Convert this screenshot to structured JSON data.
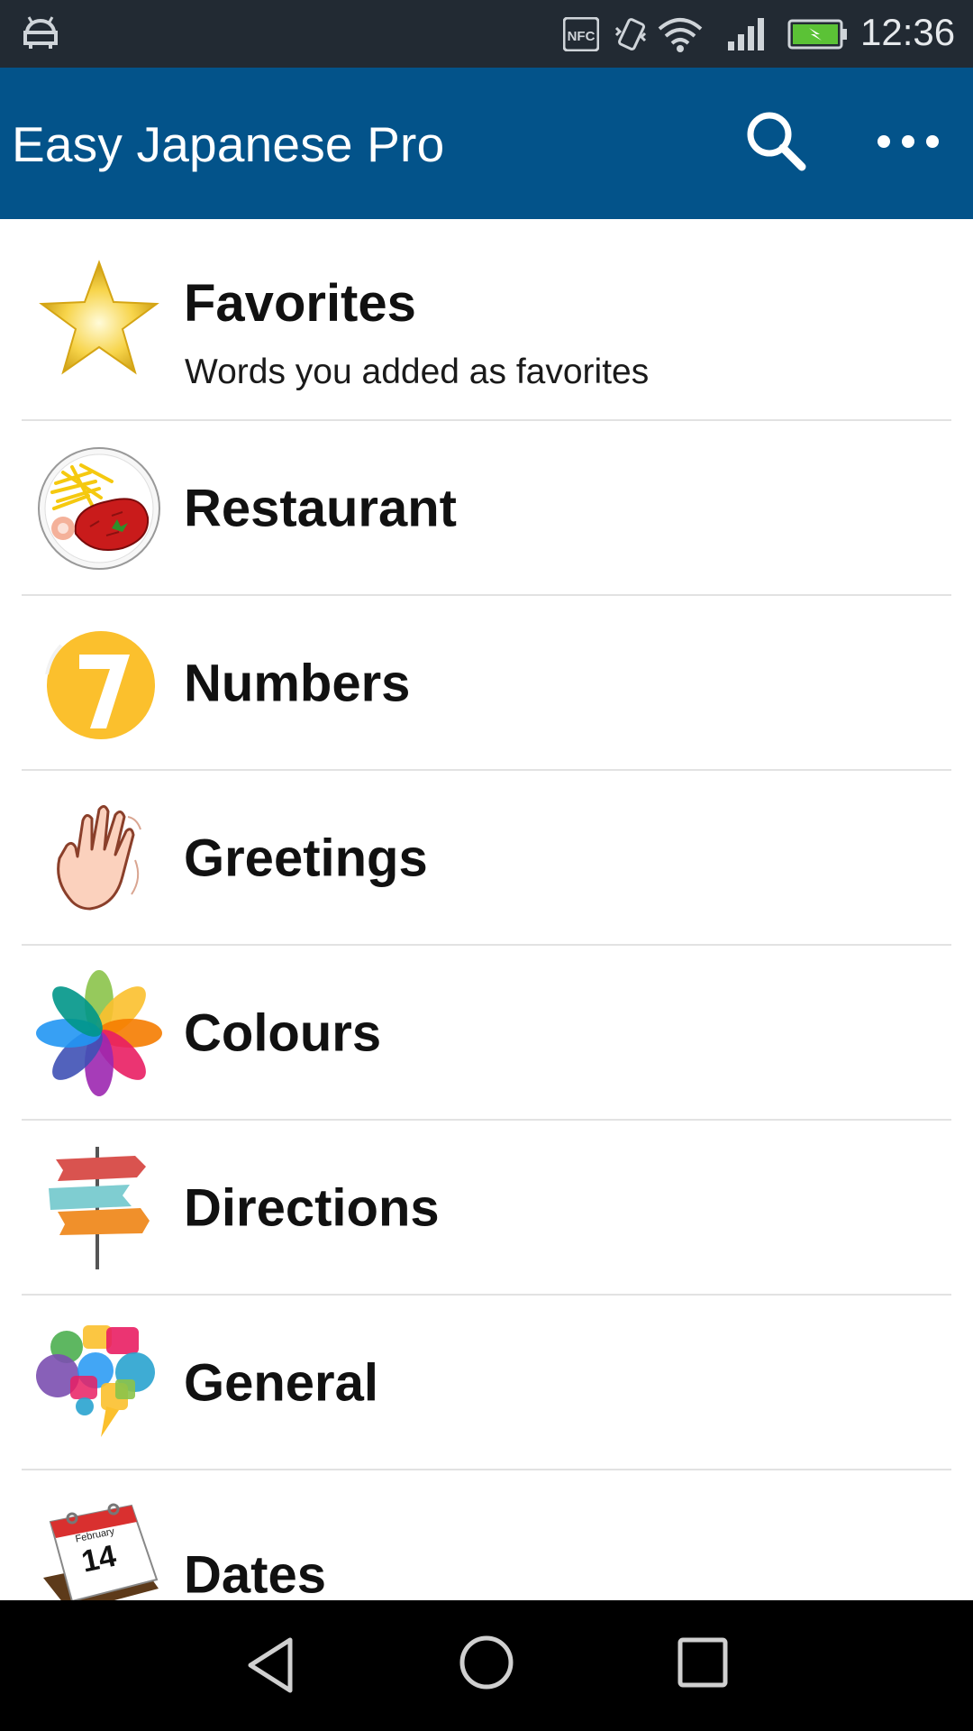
{
  "status_bar": {
    "time": "12:36",
    "nfc_label": "NFC",
    "icons": [
      "android-icon",
      "nfc-icon",
      "vibrate-icon",
      "wifi-icon",
      "signal-icon",
      "battery-charging-icon"
    ]
  },
  "app_bar": {
    "title": "Easy Japanese Pro",
    "search_icon": "search-icon",
    "more_icon": "more-horizontal-icon"
  },
  "colors": {
    "app_bar": "#03538a",
    "status_bar": "#222a33",
    "divider": "#e2e2e2"
  },
  "categories": [
    {
      "label": "Favorites",
      "sublabel": "Words you added as favorites",
      "icon": "star-icon"
    },
    {
      "label": "Restaurant",
      "icon": "steak-plate-icon"
    },
    {
      "label": "Numbers",
      "icon": "number-seven-icon"
    },
    {
      "label": "Greetings",
      "icon": "waving-hand-icon"
    },
    {
      "label": "Colours",
      "icon": "color-flower-icon"
    },
    {
      "label": "Directions",
      "icon": "signpost-icon"
    },
    {
      "label": "General",
      "icon": "speech-bubbles-icon"
    },
    {
      "label": "Dates",
      "icon": "calendar-icon",
      "calendar_month": "February",
      "calendar_day": "14"
    }
  ],
  "nav_bar": {
    "icons": [
      "back-icon",
      "home-icon",
      "recents-icon"
    ]
  }
}
